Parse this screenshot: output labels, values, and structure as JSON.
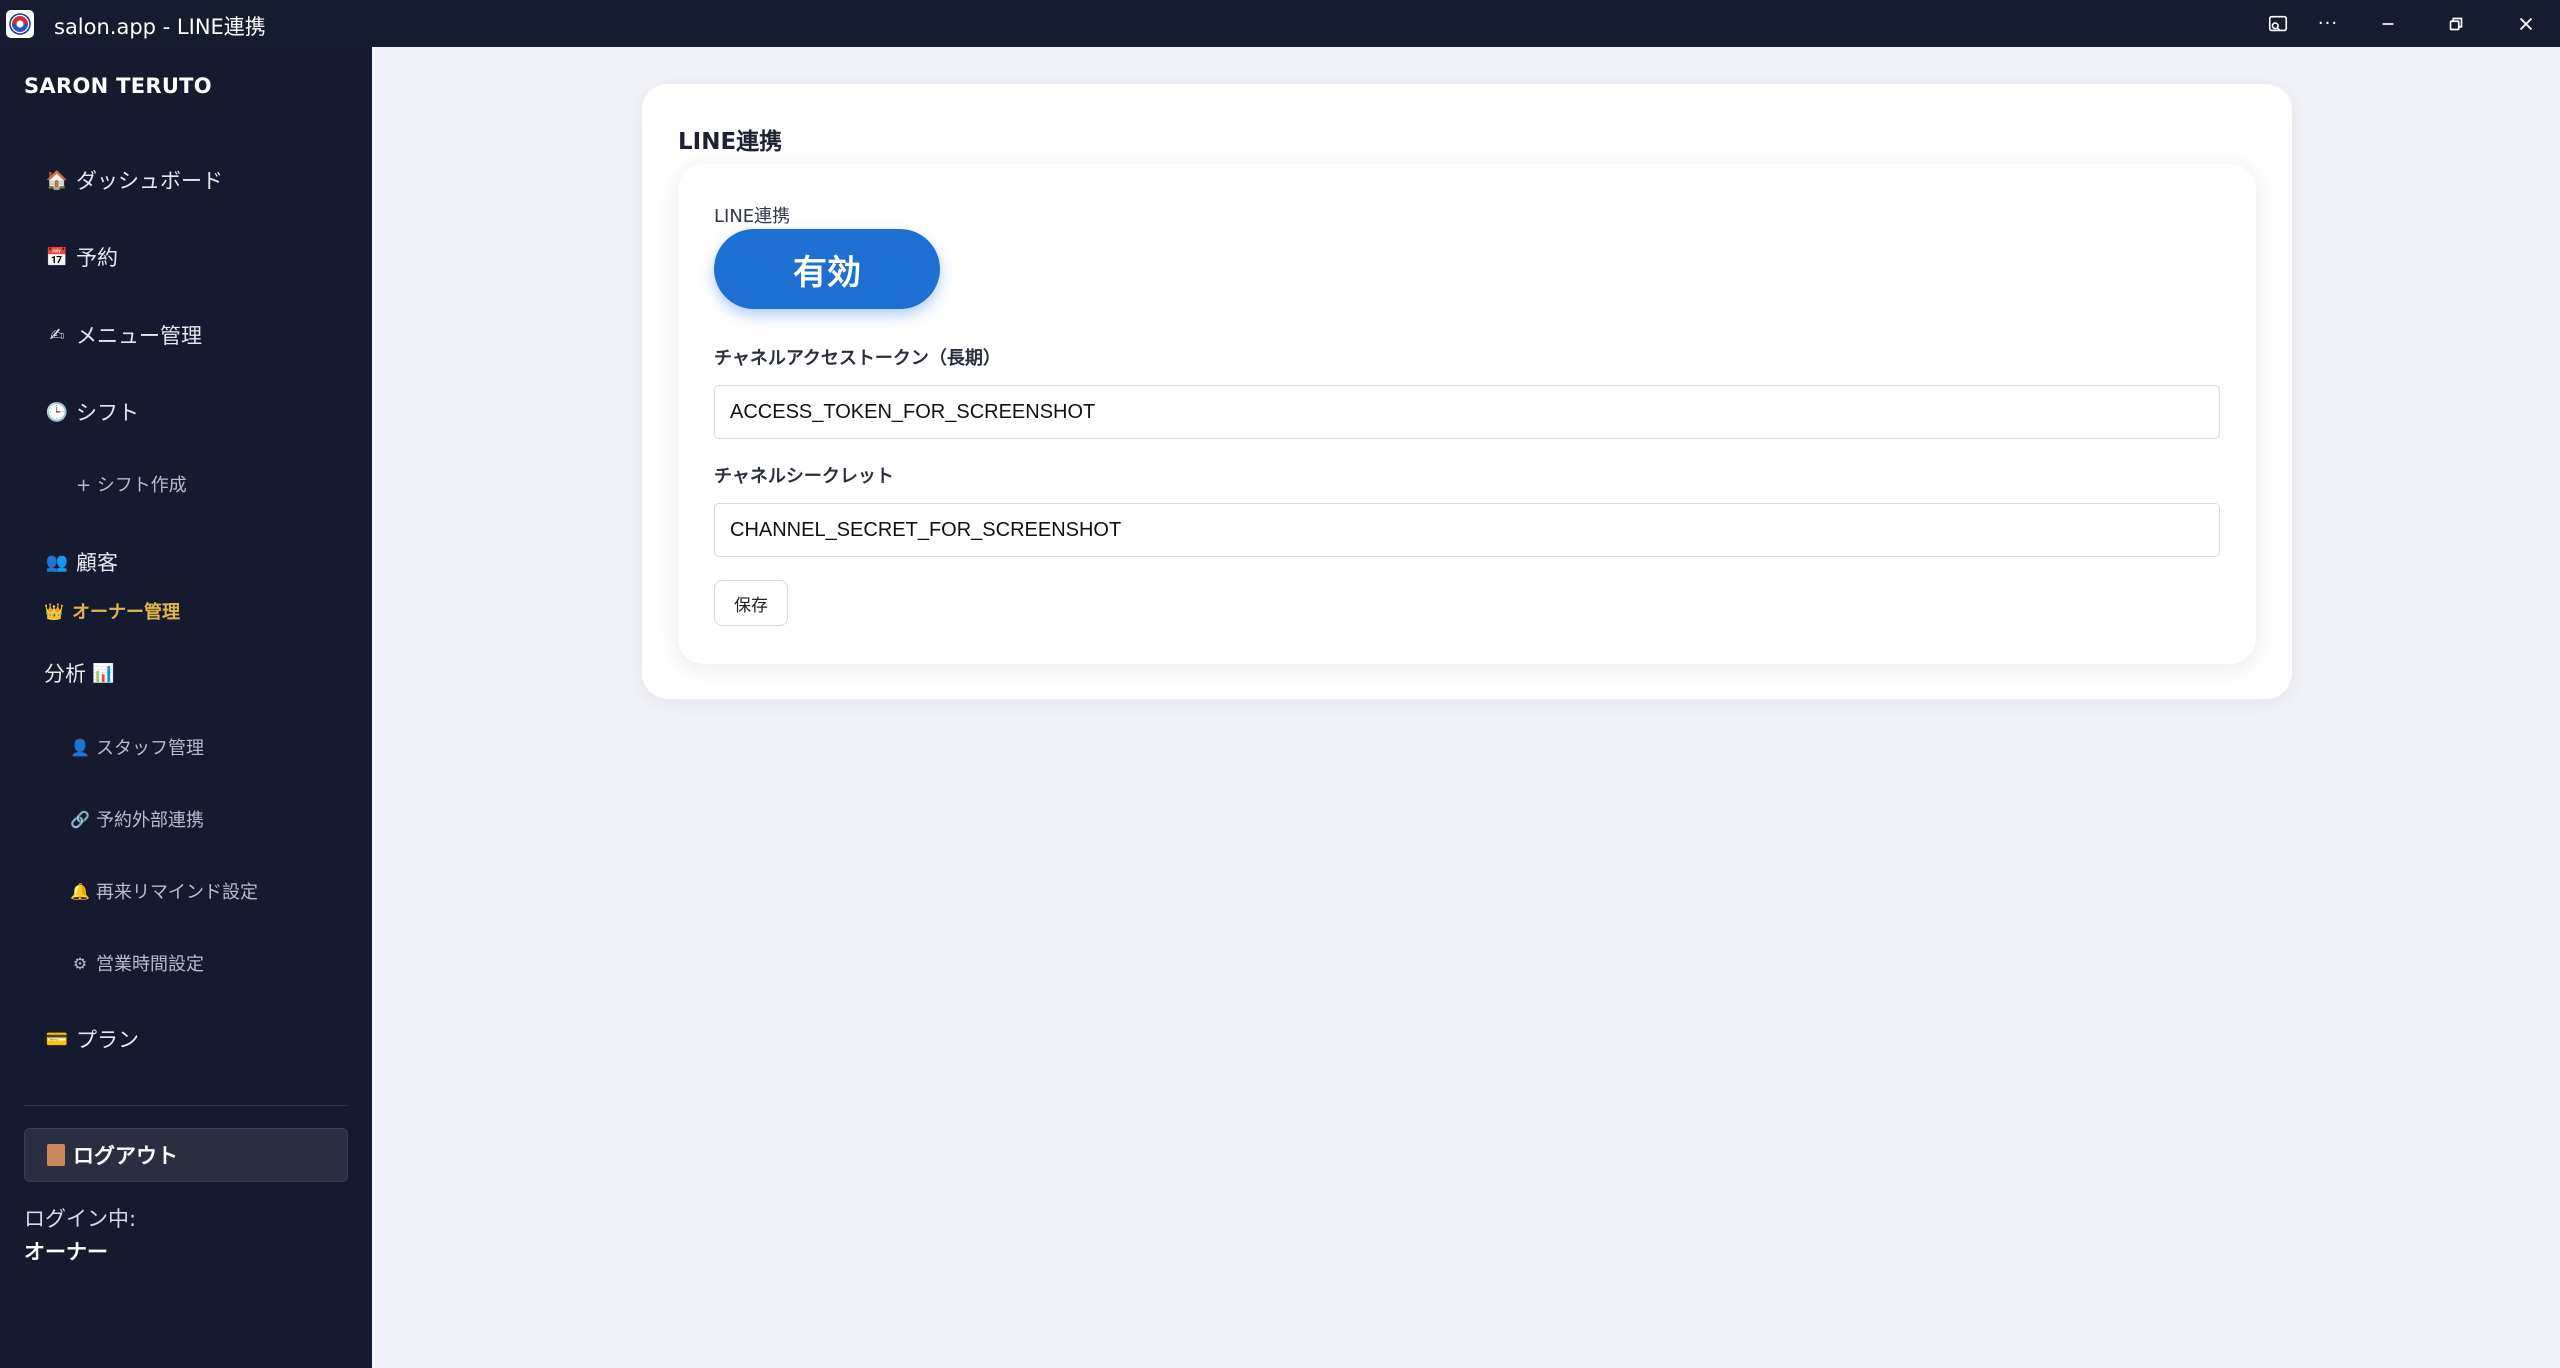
{
  "window": {
    "title": "salon.app - LINE連携",
    "controls": [
      "cast-icon",
      "more-icon",
      "minimize-icon",
      "restore-icon",
      "close-icon"
    ],
    "more_label": "···"
  },
  "sidebar": {
    "brand": "SARON TERUTO",
    "items": [
      {
        "icon": "house-icon",
        "glyph": "🏠",
        "label": "ダッシュボード"
      },
      {
        "icon": "calendar-icon",
        "glyph": "📅",
        "label": "予約"
      },
      {
        "icon": "writing-hand-icon",
        "glyph": "✍",
        "label": "メニュー管理"
      },
      {
        "icon": "clock-icon",
        "glyph": "🕒",
        "label": "シフト"
      },
      {
        "label": "+ シフト作成"
      },
      {
        "icon": "people-icon",
        "glyph": "👥",
        "label": "顧客"
      }
    ],
    "owner_section": {
      "icon": "crown-icon",
      "glyph": "👑",
      "label": "オーナー管理"
    },
    "analysis": {
      "label": "分析",
      "icon": "bar-chart-icon",
      "glyph": "📊"
    },
    "owner_items": [
      {
        "icon": "person-icon",
        "glyph": "👤",
        "label": "スタッフ管理"
      },
      {
        "icon": "link-icon",
        "glyph": "🔗",
        "label": "予約外部連携"
      },
      {
        "icon": "bell-icon",
        "glyph": "🔔",
        "label": "再来リマインド設定"
      },
      {
        "icon": "gear-icon",
        "glyph": "⚙",
        "label": "営業時間設定"
      }
    ],
    "plan": {
      "icon": "card-icon",
      "glyph": "💳",
      "label": "プラン"
    },
    "logout": {
      "icon": "door-icon",
      "label": "ログアウト"
    },
    "login_status": "ログイン中:",
    "login_user": "オーナー"
  },
  "main": {
    "title": "LINE連携",
    "line_toggle_label": "LINE連携",
    "line_toggle_value": "有効",
    "access_token_label": "チャネルアクセストークン（長期）",
    "access_token_value": "ACCESS_TOKEN_FOR_SCREENSHOT",
    "channel_secret_label": "チャネルシークレット",
    "channel_secret_value": "CHANNEL_SECRET_FOR_SCREENSHOT",
    "save_label": "保存"
  },
  "colors": {
    "titlebar": "#151c2f",
    "sidebar": "#161a2e",
    "accent": "#1e6fd2",
    "owner_accent": "#e2b64a",
    "page_bg": "#f1f2f7"
  }
}
